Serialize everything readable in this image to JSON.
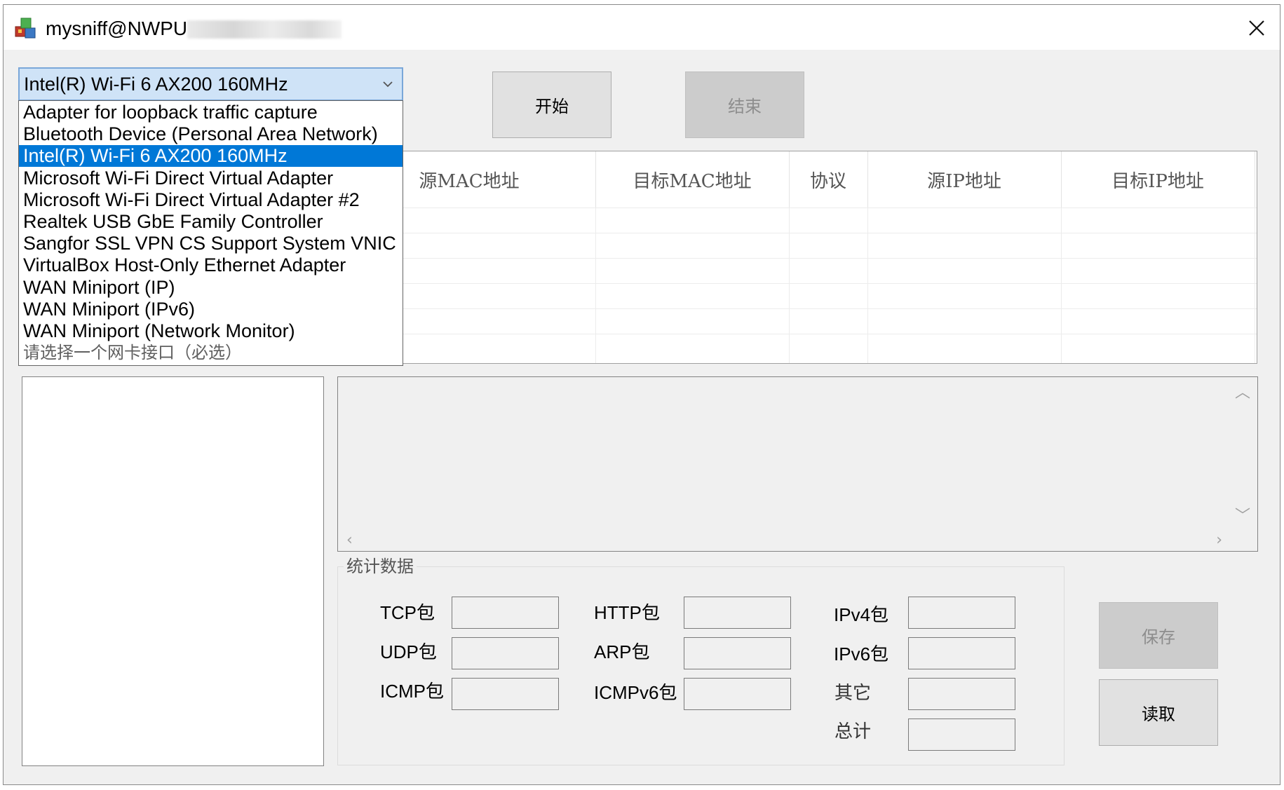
{
  "window": {
    "title": "mysniff@NWPU",
    "icon": "app-icon"
  },
  "adapter_select": {
    "selected": "Intel(R) Wi-Fi 6 AX200 160MHz",
    "options": [
      "Adapter for loopback traffic capture",
      "Bluetooth Device (Personal Area Network)",
      "Intel(R) Wi-Fi 6 AX200 160MHz",
      "Microsoft Wi-Fi Direct Virtual Adapter",
      "Microsoft Wi-Fi Direct Virtual Adapter #2",
      "Realtek USB GbE Family Controller",
      "Sangfor SSL VPN CS Support System VNIC",
      "VirtualBox Host-Only Ethernet Adapter",
      "WAN Miniport (IP)",
      "WAN Miniport (IPv6)",
      "WAN Miniport (Network Monitor)",
      "请选择一个网卡接口（必选）"
    ]
  },
  "buttons": {
    "start": "开始",
    "stop": "结束",
    "save": "保存",
    "read": "读取"
  },
  "table": {
    "columns": [
      "源MAC地址",
      "目标MAC地址",
      "协议",
      "源IP地址",
      "目标IP地址"
    ]
  },
  "stats": {
    "title": "统计数据",
    "tcp": "TCP包",
    "udp": "UDP包",
    "icmp": "ICMP包",
    "http": "HTTP包",
    "arp": "ARP包",
    "icmpv6": "ICMPv6包",
    "ipv4": "IPv4包",
    "ipv6": "IPv6包",
    "other": "其它",
    "total": "总计"
  },
  "colors": {
    "selection": "#0078d7",
    "select_focus": "#cfe3f7",
    "window_bg": "#f0f0f0"
  }
}
